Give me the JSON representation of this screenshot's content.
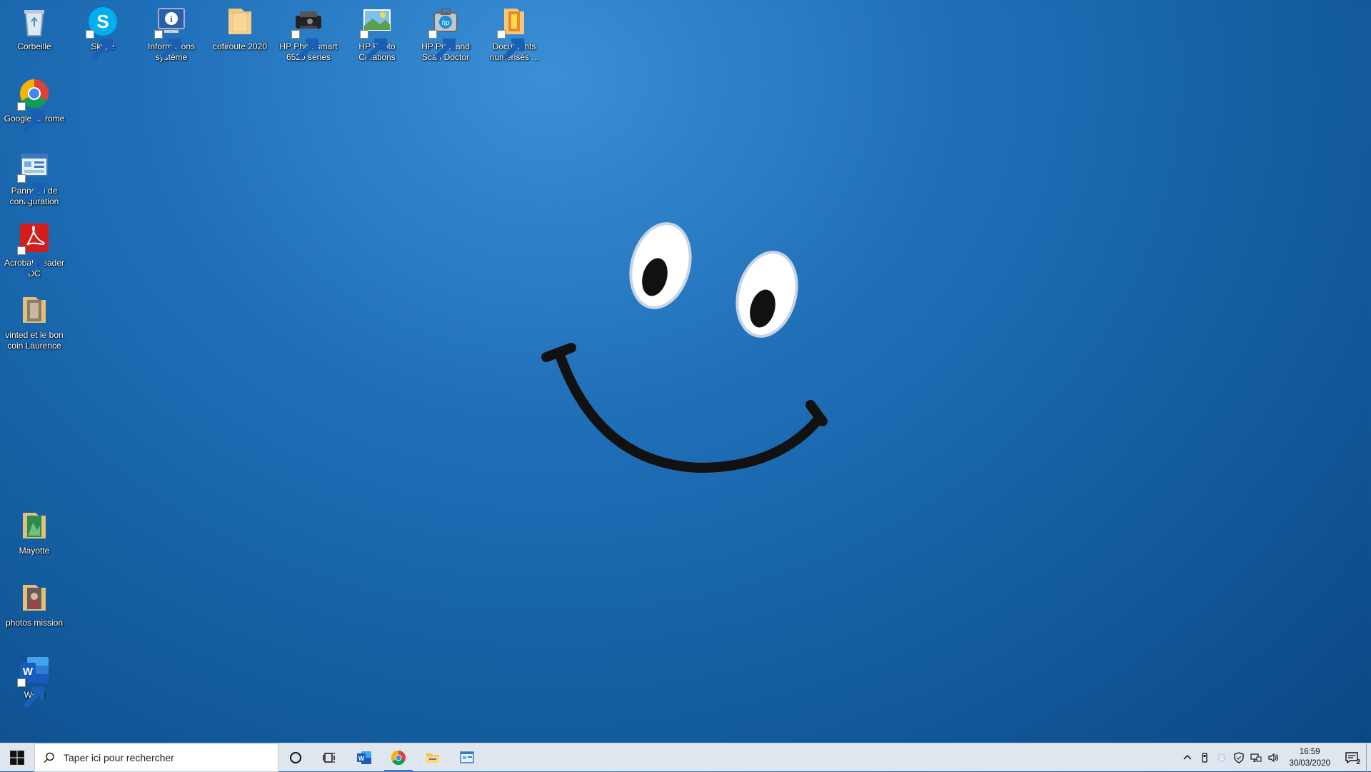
{
  "desktop": {
    "icons": [
      {
        "label": "Corbeille",
        "icon": "recycle-bin-icon"
      },
      {
        "label": "Skype",
        "icon": "skype-icon"
      },
      {
        "label": "Informations système",
        "icon": "system-info-icon"
      },
      {
        "label": "cofiroute 2020",
        "icon": "folder-icon"
      },
      {
        "label": "HP Photosmart 6520 series",
        "icon": "printer-icon"
      },
      {
        "label": "HP Photo Creations",
        "icon": "hp-photo-icon"
      },
      {
        "label": "HP Print and Scan Doctor",
        "icon": "hp-doctor-icon"
      },
      {
        "label": "Documents numérisés ...",
        "icon": "folder-icon"
      },
      {
        "label": "Google Chrome",
        "icon": "chrome-icon"
      },
      {
        "label": "Panneau de configuration",
        "icon": "control-panel-icon"
      },
      {
        "label": "Acrobat Reader DC",
        "icon": "acrobat-icon"
      },
      {
        "label": "vinted et le bon coin Laurence",
        "icon": "folder-icon"
      },
      {
        "label": "Mayotte",
        "icon": "folder-icon"
      },
      {
        "label": "photos mission",
        "icon": "folder-icon"
      },
      {
        "label": "Word",
        "icon": "word-icon"
      }
    ]
  },
  "taskbar": {
    "search_placeholder": "Taper ici pour rechercher",
    "pinned": [
      "cortana-icon",
      "task-view-icon",
      "word-icon",
      "chrome-icon",
      "file-explorer-icon",
      "control-panel-icon"
    ],
    "active_app": "chrome-icon",
    "tray": [
      "chevron-up-icon",
      "usb-icon",
      "skype-tray-icon",
      "security-icon",
      "network-icon",
      "volume-icon"
    ],
    "time": "16:59",
    "date": "30/03/2020",
    "notification_count": "2"
  },
  "colors": {
    "wallpaper": "#1f6fb8",
    "taskbar": "#dfe6ee",
    "accent": "#3a7bd5"
  }
}
